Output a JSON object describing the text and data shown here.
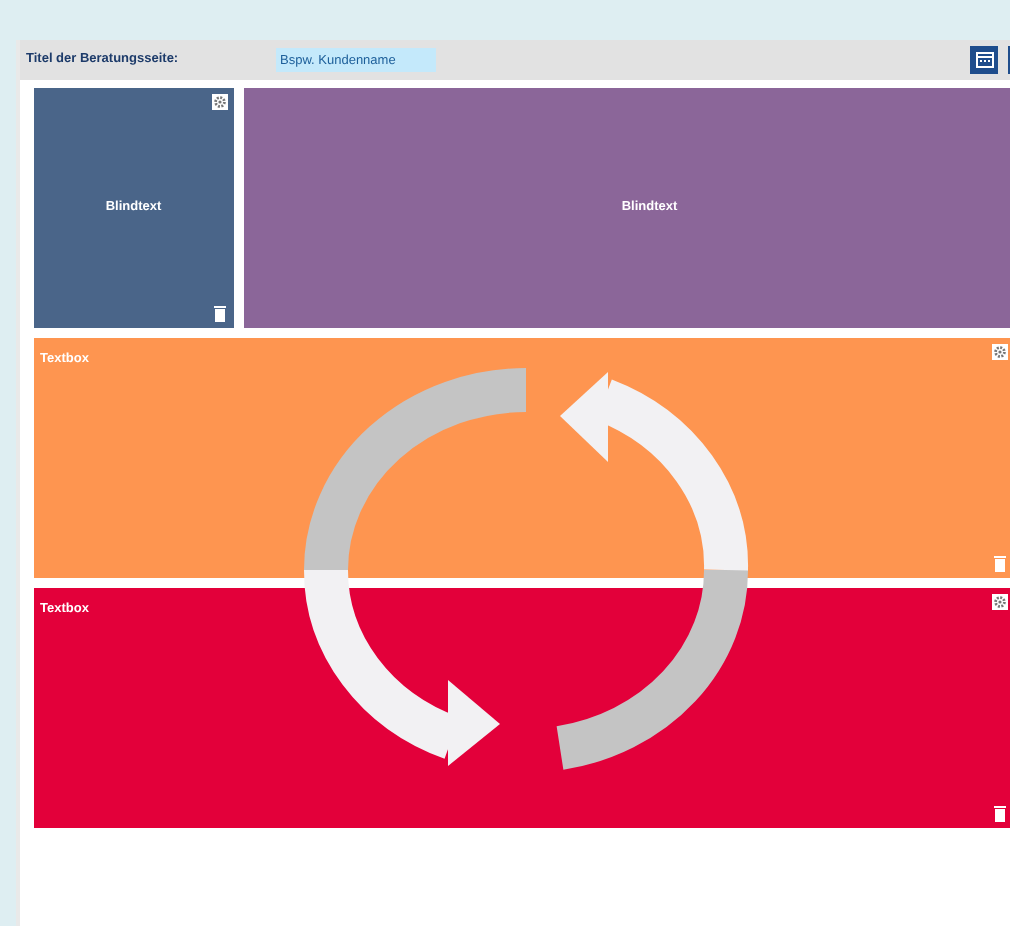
{
  "header": {
    "title_label": "Titel der Beratungsseite:",
    "title_field": {
      "value": "Bspw. Kundenname"
    }
  },
  "rows": [
    {
      "tiles": [
        {
          "kind": "label",
          "text": "Blindtext",
          "color": "#4a6589"
        },
        {
          "kind": "label",
          "text": "Blindtext",
          "color": "#8b6699"
        }
      ]
    },
    {
      "tiles": [
        {
          "kind": "textbox",
          "text": "Textbox",
          "color": "#fe9550"
        }
      ]
    },
    {
      "tiles": [
        {
          "kind": "textbox",
          "text": "Textbox",
          "color": "#e3003a"
        }
      ]
    }
  ]
}
